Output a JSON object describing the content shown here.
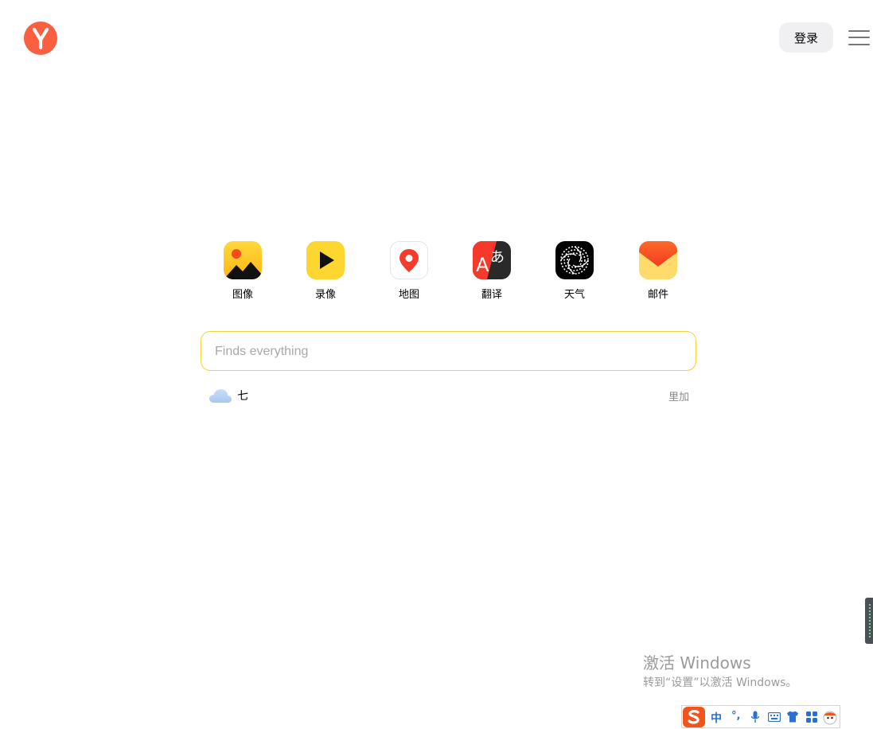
{
  "header": {
    "login_label": "登录"
  },
  "services": [
    {
      "label": "图像",
      "icon": "images-icon"
    },
    {
      "label": "录像",
      "icon": "video-play-icon"
    },
    {
      "label": "地图",
      "icon": "map-pin-icon"
    },
    {
      "label": "翻译",
      "icon": "translate-icon"
    },
    {
      "label": "天气",
      "icon": "weather-swirl-icon"
    },
    {
      "label": "邮件",
      "icon": "mail-envelope-icon"
    }
  ],
  "search": {
    "placeholder": "Finds everything",
    "value": ""
  },
  "weather": {
    "temperature": "七",
    "icon": "cloud-icon"
  },
  "more_link": "里加",
  "windows_activation": {
    "title": "激活 Windows",
    "subtitle": "转到“设置”以激活 Windows。"
  },
  "ime_bar": {
    "mode": "中",
    "punct": "°,"
  },
  "colors": {
    "brand": "#fc5f40",
    "search_border": "#f5d33b"
  }
}
